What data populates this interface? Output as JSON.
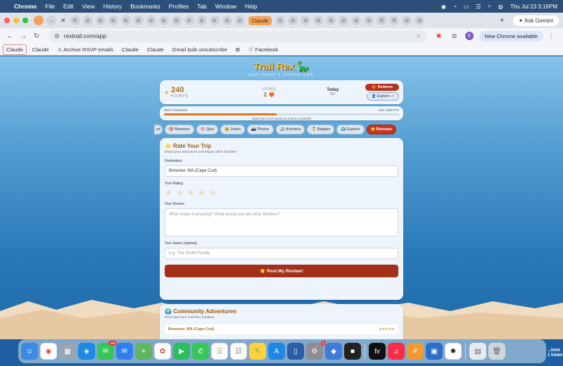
{
  "menubar": {
    "app": "Chrome",
    "menus": [
      "File",
      "Edit",
      "View",
      "History",
      "Bookmarks",
      "Profiles",
      "Tab",
      "Window",
      "Help"
    ],
    "datetime": "Thu Jul 23  3:16PM"
  },
  "tabs": {
    "active_label": "Claude",
    "gemini_label": "Ask Gemini"
  },
  "toolbar": {
    "url": "rextrail.com/app",
    "profile_initial": "S",
    "update_label": "New Chrome available"
  },
  "bookmarks": [
    "Claude",
    "Claude",
    "Archive RSVP emails",
    "Claude",
    "Claude",
    "Gmail bulk unsubscribe",
    "Facebook"
  ],
  "brand": {
    "logo": "Trail Rex 🦕",
    "tagline": "EXPLORER'S ADVENTURE"
  },
  "stats": {
    "points": "240",
    "points_label": "POINTS",
    "level_label": "LEVEL",
    "level_value": "2 🦊",
    "today_label": "Today",
    "today_value": "83°",
    "redeem_label": "🎁 Redeem",
    "explorer_label": "👤 Explorer ✓"
  },
  "reward": {
    "label": "NEXT REWARD",
    "progress_text": "240 / 500 PTS",
    "progress_fraction": 0.48,
    "hint": "Need 260 more points to unlock a reward!"
  },
  "nav": {
    "tabs": [
      "es",
      "🎯 Missions",
      "🧠 Quiz",
      "😂 Jokes",
      "📷 Photos",
      "🏕 Activities",
      "🏅 Badges",
      "🌍 Explore",
      "⭐ Reviews"
    ],
    "active": "⭐ Reviews"
  },
  "review_form": {
    "title": "⭐ Rate Your Trip",
    "subtitle": "Share your adventure and inspire other families!",
    "destination_label": "Destination",
    "destination_value": "Brewster, MA (Cape Cod)",
    "rating_label": "Your Rating",
    "rating_value": 0,
    "review_label": "Your Review",
    "review_placeholder": "What made it amazing? What would you tell other families?",
    "name_label": "Your Name (optimal)",
    "name_placeholder": "e.g. The Smith Family",
    "submit_label": "⭐ Post My Review!"
  },
  "community": {
    "title": "🌍 Community Adventures",
    "subtitle": "Real trips from Trail Rex families!",
    "first_item": "Brewster, MA (Cape Cod)",
    "first_item_stars": "★★★★★"
  },
  "dock": {
    "messages_badge": "466",
    "settings_badge": "1",
    "desktop_label": "...html\n1 folder"
  },
  "colors": {
    "accent_red": "#c6361f",
    "brand_gold": "#f6c64a",
    "sky": "#4f9bd0"
  }
}
